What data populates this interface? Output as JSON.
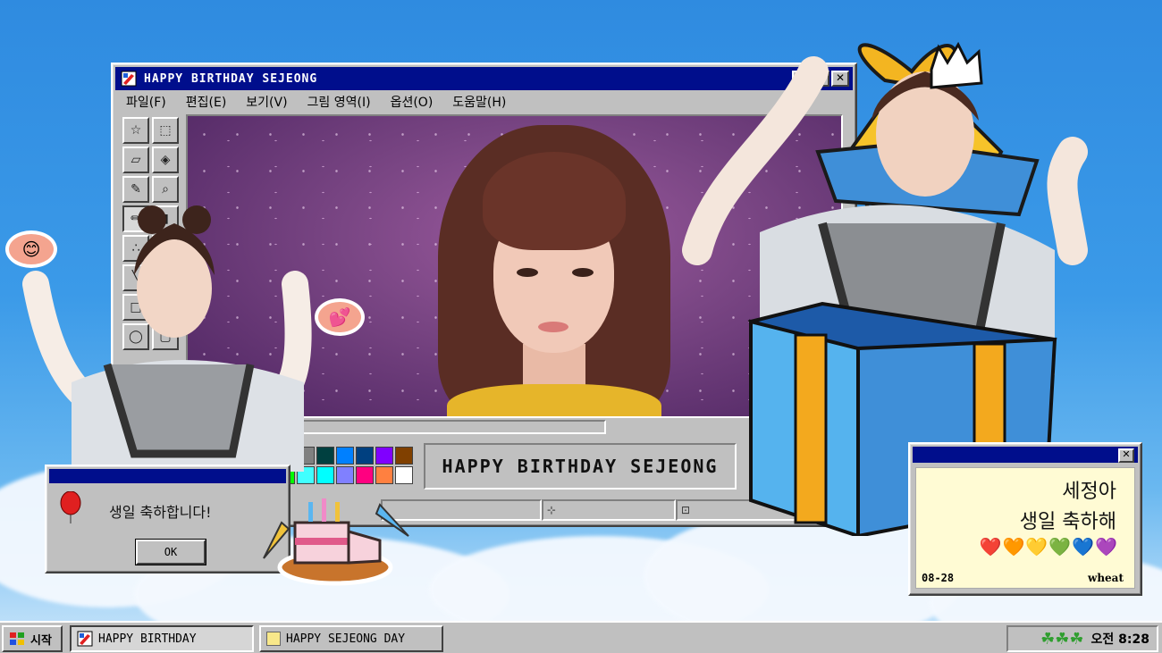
{
  "window": {
    "title": "HAPPY BIRTHDAY SEJEONG",
    "menu": [
      "파일(F)",
      "편집(E)",
      "보기(V)",
      "그림 영역(I)",
      "옵션(O)",
      "도움말(H)"
    ],
    "banner": "HAPPY BIRTHDAY SEJEONG",
    "buttons": {
      "minimize": "_",
      "maximize": "□",
      "close": "✕"
    }
  },
  "tools": [
    "free-select",
    "rect-select",
    "eraser",
    "fill",
    "picker",
    "magnifier",
    "pencil",
    "brush",
    "airbrush",
    "text",
    "line",
    "curve",
    "rectangle",
    "polygon",
    "ellipse",
    "rounded-rect"
  ],
  "palette": [
    "#008080",
    "#808000",
    "#ff00ff",
    "#808080",
    "#004040",
    "#0080ff",
    "#004080",
    "#8000ff",
    "#804000",
    "#00ffff",
    "#ffff00",
    "#00ff00",
    "#40ffff",
    "#00ffff",
    "#8080ff",
    "#ff0080",
    "#ff8040",
    "#ffffff"
  ],
  "dialog": {
    "message": "생일 축하합니다!",
    "ok": "OK"
  },
  "note": {
    "line1": "세정아",
    "line2": "생일 축하해",
    "hearts": "❤️🧡💛💚💙💜",
    "date": "08-28",
    "signature": "wheat",
    "close": "✕"
  },
  "taskbar": {
    "start": "시작",
    "tasks": [
      "HAPPY BIRTHDAY",
      "HAPPY SEJEONG DAY"
    ],
    "tray_icons": "☘☘☘",
    "clock": "오전 8:28"
  },
  "colors": {
    "titlebar": "#000e8c",
    "chrome": "#c0c0c0",
    "sky": "#3b9ae8"
  }
}
